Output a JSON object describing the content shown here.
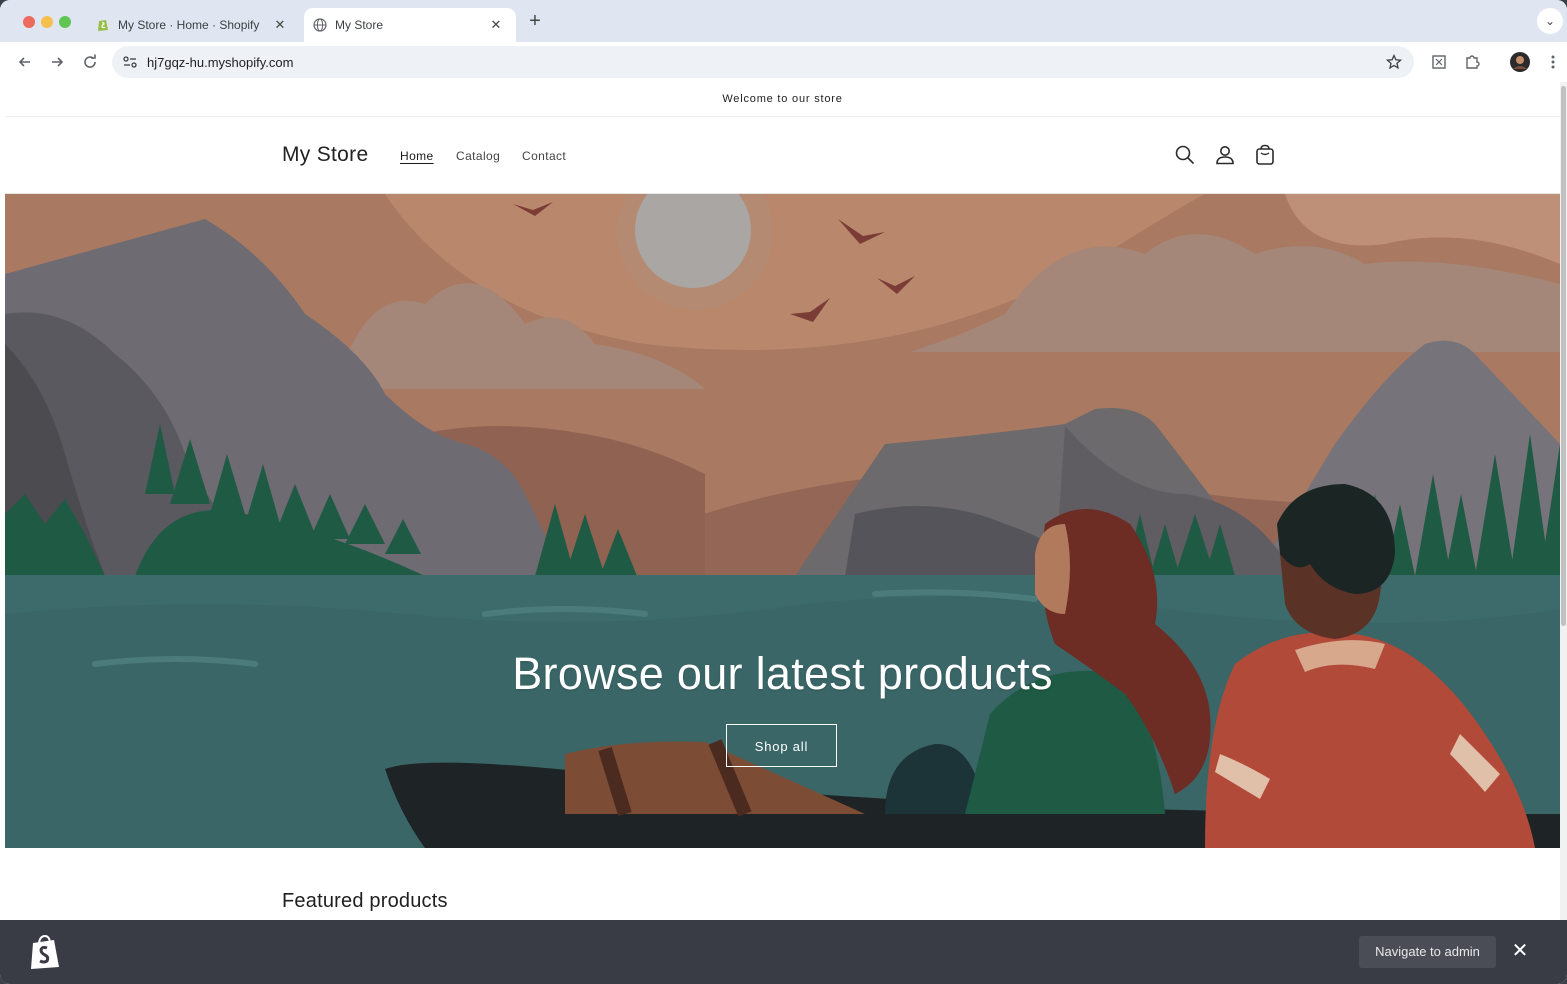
{
  "browser": {
    "tabs": [
      {
        "title": "My Store · Home · Shopify",
        "active": false,
        "icon": "shopify-favicon"
      },
      {
        "title": "My Store",
        "active": true,
        "icon": "globe-favicon"
      }
    ],
    "close_glyph": "✕",
    "new_tab_glyph": "+",
    "dropdown_glyph": "⌄",
    "url": "hj7gqz-hu.myshopify.com"
  },
  "store": {
    "announcement": "Welcome to our store",
    "logo": "My Store",
    "nav": [
      {
        "label": "Home",
        "active": true
      },
      {
        "label": "Catalog",
        "active": false
      },
      {
        "label": "Contact",
        "active": false
      }
    ],
    "header_icons": [
      "search-icon",
      "account-icon",
      "cart-icon"
    ]
  },
  "hero": {
    "heading": "Browse our latest products",
    "button": "Shop all"
  },
  "featured": {
    "title": "Featured products"
  },
  "admin_bar": {
    "navigate_label": "Navigate to admin",
    "close_glyph": "✕"
  },
  "colors": {
    "tabstrip": "#dfe6f1",
    "admin_bar": "#393c45",
    "sky": "#b07e66",
    "lake": "#3d6d6e"
  }
}
